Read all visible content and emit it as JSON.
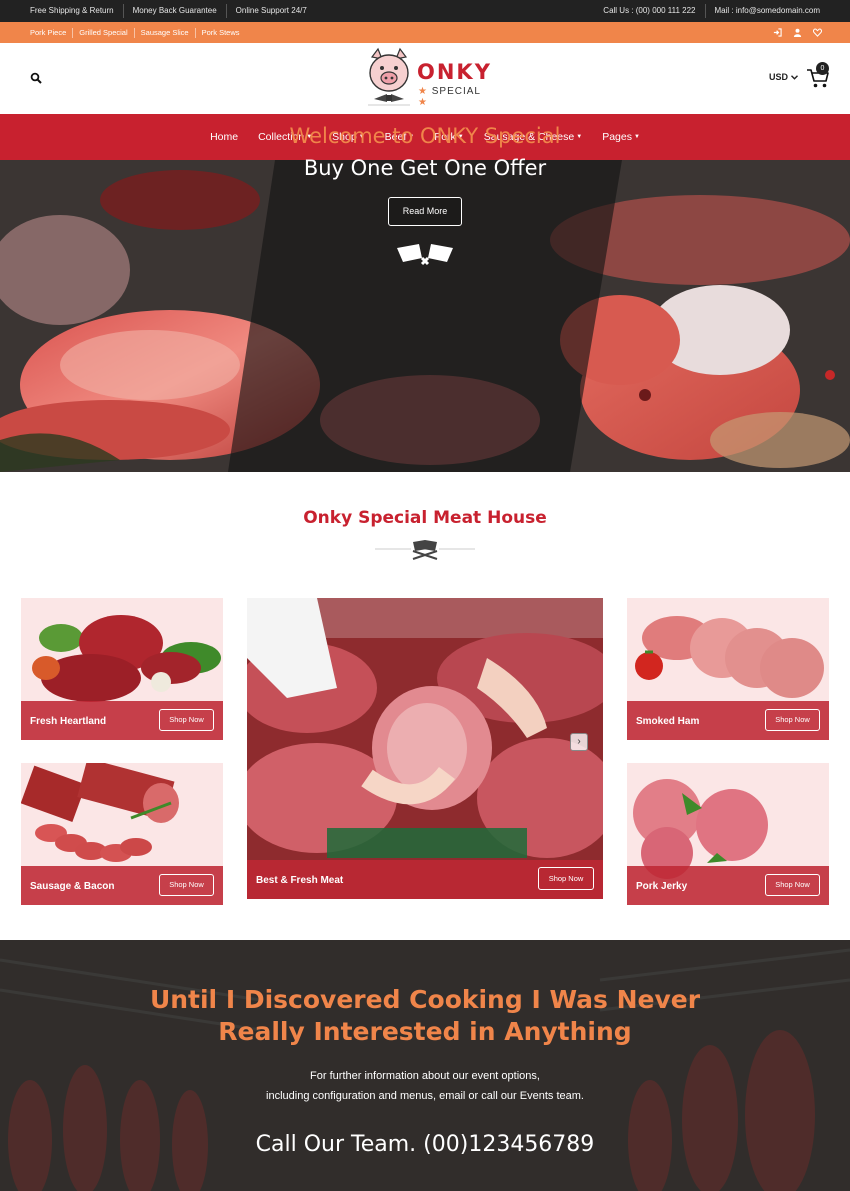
{
  "topbar": {
    "left": [
      "Free Shipping & Return",
      "Money Back Guarantee",
      "Online Support 24/7"
    ],
    "call": "Call Us : (00) 000 111 222",
    "mail": "Mail : info@somedomain.com"
  },
  "quick_links": [
    "Pork Piece",
    "Grilled Special",
    "Sausage Slice",
    "Pork Stews"
  ],
  "account_icons": [
    "login-icon",
    "user-icon",
    "heart-icon"
  ],
  "header": {
    "logo_word": "ONKY",
    "logo_sub": "SPECIAL",
    "currency": "USD",
    "cart_count": "0"
  },
  "nav": {
    "items": [
      {
        "label": "Home",
        "dropdown": false
      },
      {
        "label": "Collection",
        "dropdown": true
      },
      {
        "label": "Shop",
        "dropdown": true
      },
      {
        "label": "Beef",
        "dropdown": true
      },
      {
        "label": "Pork",
        "dropdown": true
      },
      {
        "label": "Sausage & Cheese",
        "dropdown": true
      },
      {
        "label": "Pages",
        "dropdown": true
      }
    ]
  },
  "hero": {
    "title": "Welcome to ONKY Special",
    "subtitle": "Buy One Get One Offer",
    "button": "Read More"
  },
  "section": {
    "title": "Onky Special Meat House"
  },
  "products": {
    "shop_label": "Shop Now",
    "items": [
      {
        "name": "Fresh Heartland"
      },
      {
        "name": "Sausage & Bacon"
      },
      {
        "name": "Best & Fresh Meat"
      },
      {
        "name": "Smoked Ham"
      },
      {
        "name": "Pork Jerky"
      }
    ]
  },
  "bottom": {
    "quote_line1": "Until I Discovered Cooking I Was Never",
    "quote_line2": "Really Interested in Anything",
    "info_line1": "For further information about our event options,",
    "info_line2": "including configuration and menus, email or call our Events team.",
    "call": "Call Our Team. (00)123456789"
  },
  "colors": {
    "brand_red": "#c8212f",
    "accent_orange": "#f0854a",
    "topbar": "#222222"
  }
}
